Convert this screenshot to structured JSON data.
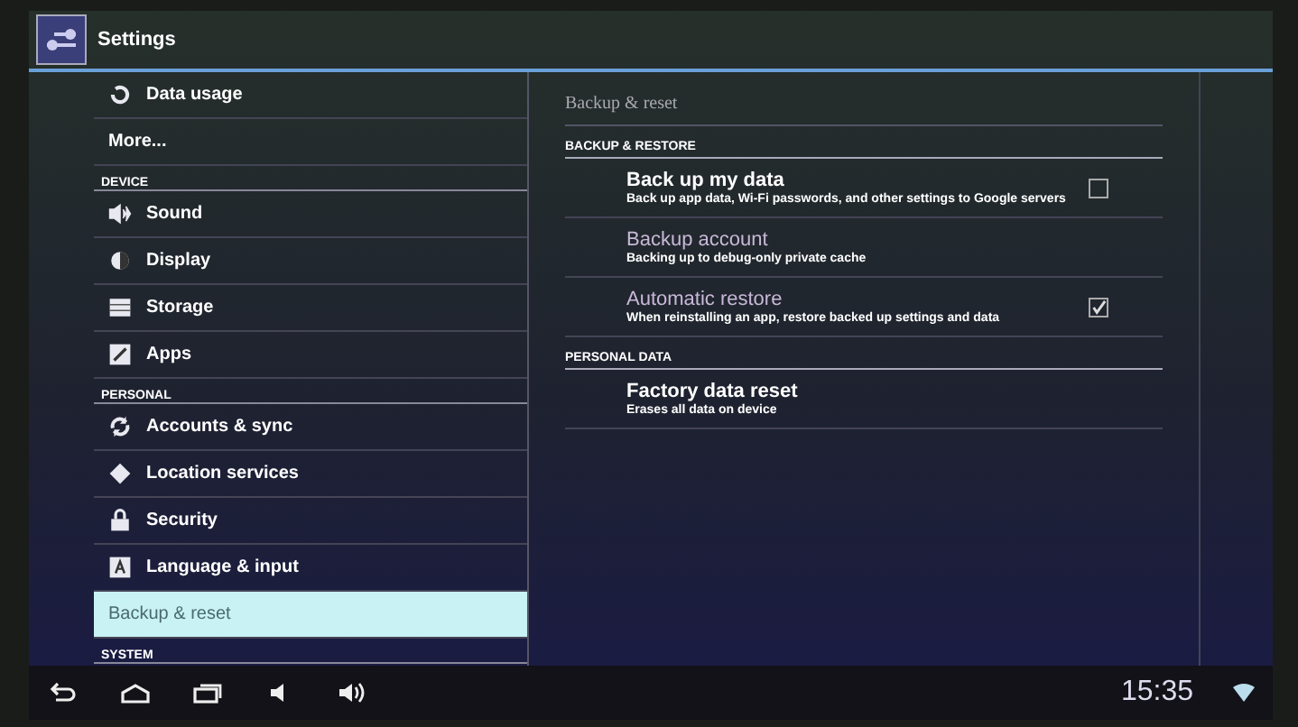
{
  "action_bar": {
    "title": "Settings"
  },
  "sidebar": {
    "items": [
      {
        "kind": "item",
        "label": "Data usage",
        "selected": false
      },
      {
        "kind": "item",
        "label": "More...",
        "selected": false
      },
      {
        "kind": "header",
        "label": "DEVICE"
      },
      {
        "kind": "item",
        "label": "Sound",
        "selected": false
      },
      {
        "kind": "item",
        "label": "Display",
        "selected": false
      },
      {
        "kind": "item",
        "label": "Storage",
        "selected": false
      },
      {
        "kind": "item",
        "label": "Apps",
        "selected": false
      },
      {
        "kind": "header",
        "label": "PERSONAL"
      },
      {
        "kind": "item",
        "label": "Accounts & sync",
        "selected": false
      },
      {
        "kind": "item",
        "label": "Location services",
        "selected": false
      },
      {
        "kind": "item",
        "label": "Security",
        "selected": false
      },
      {
        "kind": "item",
        "label": "Language & input",
        "selected": false
      },
      {
        "kind": "item",
        "label": "Backup & reset",
        "selected": true
      },
      {
        "kind": "header",
        "label": "SYSTEM"
      }
    ]
  },
  "detail": {
    "title": "Backup & reset",
    "sections": [
      {
        "header": "BACKUP & RESTORE",
        "rows": [
          {
            "title": "Back up my data",
            "summary": "Back up app data, Wi-Fi passwords, and other settings to Google servers",
            "disabled": false,
            "checked": false
          },
          {
            "title": "Backup account",
            "summary": "Backing up to debug-only private cache",
            "disabled": true
          },
          {
            "title": "Automatic restore",
            "summary": "When reinstalling an app, restore backed up settings and data",
            "disabled": true,
            "checked": true
          }
        ]
      },
      {
        "header": "PERSONAL DATA",
        "rows": [
          {
            "title": "Factory data reset",
            "summary": "Erases all data on device",
            "disabled": false
          }
        ]
      }
    ]
  },
  "status_bar": {
    "time": "15:35"
  }
}
